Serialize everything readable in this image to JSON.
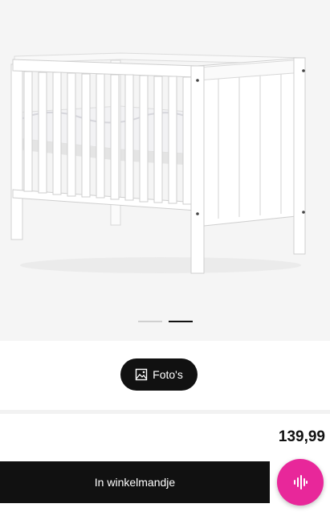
{
  "product": {
    "image_alt": "white crib",
    "photos_button_label": "Foto's",
    "price": "139,99",
    "add_to_cart_label": "In winkelmandje"
  },
  "carousel": {
    "total": 2,
    "active_index": 1
  },
  "icons": {
    "photos": "image-icon",
    "voice": "audio-waveform-icon"
  },
  "colors": {
    "button_dark": "#111111",
    "voice_accent": "#e8279a"
  }
}
